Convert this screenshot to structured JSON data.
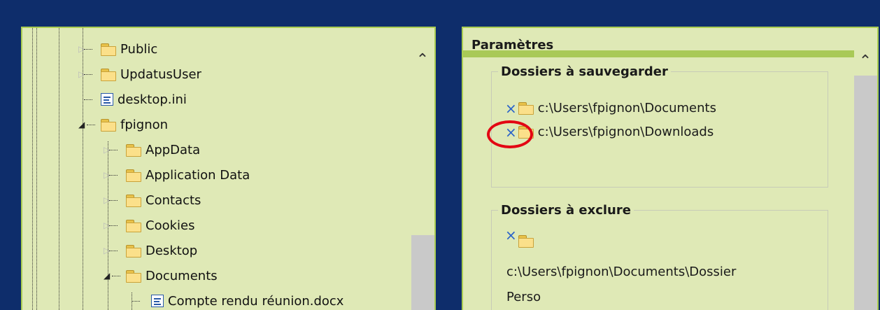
{
  "tree": {
    "items": [
      {
        "label": "Public",
        "type": "folder",
        "expander": "collapsed"
      },
      {
        "label": "UpdatusUser",
        "type": "folder",
        "expander": "collapsed"
      },
      {
        "label": "desktop.ini",
        "type": "file",
        "expander": "none"
      },
      {
        "label": "fpignon",
        "type": "folder",
        "expander": "expanded"
      },
      {
        "label": "AppData",
        "type": "folder",
        "expander": "collapsed"
      },
      {
        "label": "Application Data",
        "type": "folder",
        "expander": "collapsed"
      },
      {
        "label": "Contacts",
        "type": "folder",
        "expander": "collapsed"
      },
      {
        "label": "Cookies",
        "type": "folder",
        "expander": "collapsed"
      },
      {
        "label": "Desktop",
        "type": "folder",
        "expander": "collapsed"
      },
      {
        "label": "Documents",
        "type": "folder",
        "expander": "expanded"
      },
      {
        "label": "Compte rendu réunion.docx",
        "type": "file",
        "expander": "none"
      }
    ]
  },
  "settings": {
    "title": "Paramètres",
    "backup": {
      "legend": "Dossiers à sauvegarder",
      "paths": [
        "c:\\Users\\fpignon\\Documents",
        "c:\\Users\\fpignon\\Downloads"
      ]
    },
    "exclude": {
      "legend": "Dossiers à exclure",
      "path_line1": "c:\\Users\\fpignon\\Documents\\Dossier",
      "path_line2": "Perso"
    }
  },
  "icons": {
    "remove": "×",
    "scroll_up": "⌃"
  },
  "colors": {
    "background": "#0e2d6b",
    "panel": "#dfe9b6",
    "panel_border": "#aacd52",
    "header_underline": "#a9c957",
    "remove_icon": "#2a63c9",
    "highlight_circle": "#e30613"
  }
}
